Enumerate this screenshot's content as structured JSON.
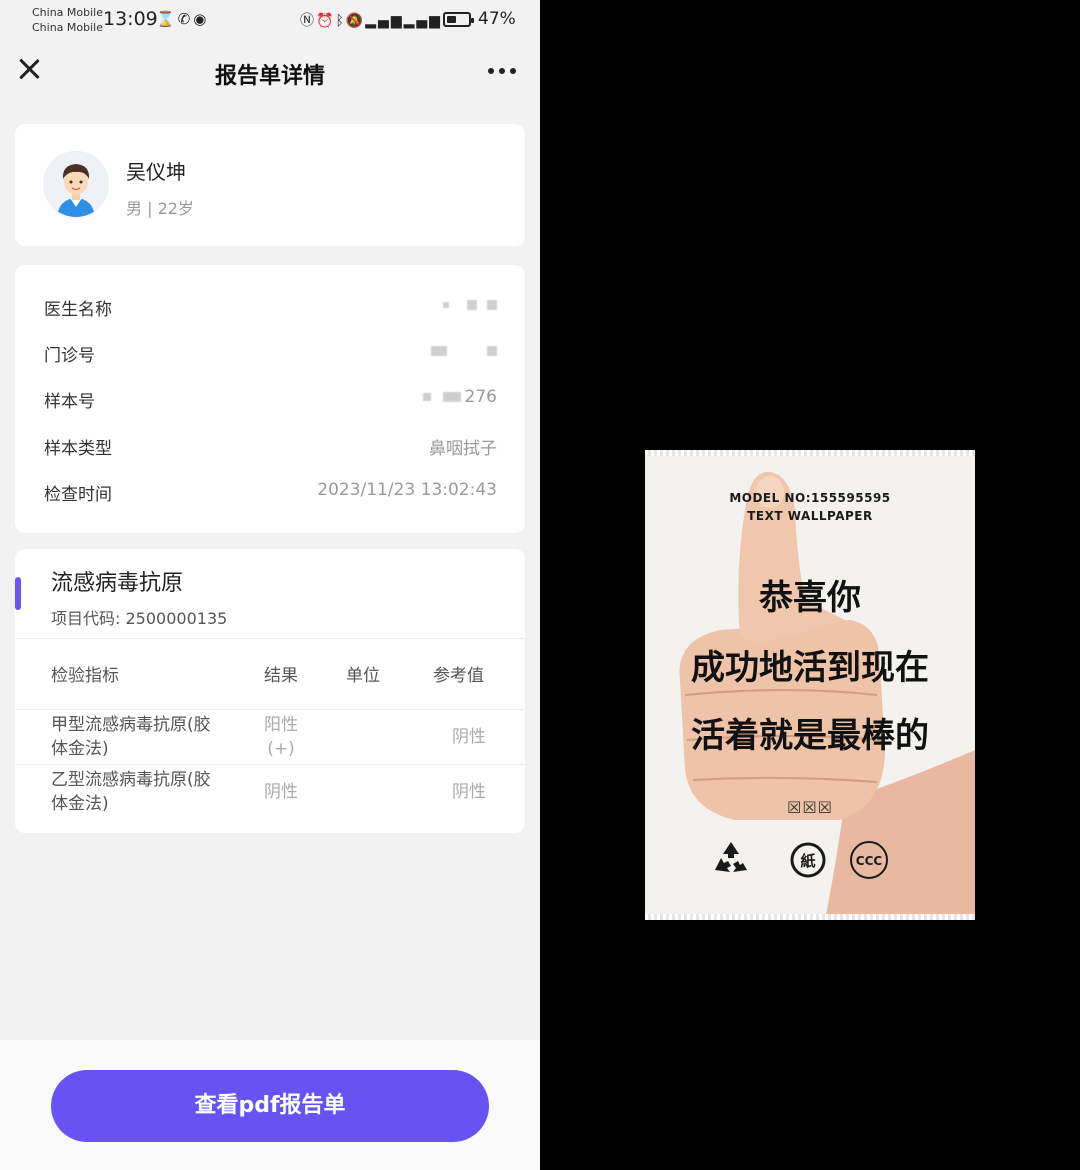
{
  "status_bar": {
    "carrier_1": "China Mobile",
    "carrier_2": "China Mobile",
    "time": "13:09",
    "battery": "47%",
    "battery_level": 0.47
  },
  "nav": {
    "title": "报告单详情"
  },
  "patient": {
    "name": "吴仪坤",
    "meta": "男 | 22岁"
  },
  "info": {
    "rows": [
      {
        "label": "医生名称",
        "value": ""
      },
      {
        "label": "门诊号",
        "value": ""
      },
      {
        "label": "样本号",
        "value": "276"
      },
      {
        "label": "样本类型",
        "value": "鼻咽拭子"
      },
      {
        "label": "检查时间",
        "value": "2023/11/23 13:02:43"
      }
    ]
  },
  "project": {
    "title": "流感病毒抗原",
    "code_label": "项目代码:",
    "code_value": "2500000135",
    "columns": [
      "检验指标",
      "结果",
      "单位",
      "参考值"
    ],
    "rows": [
      {
        "name_line1": "甲型流感病毒抗原(胶",
        "name_line2": "体金法)",
        "result_line1": "阳性",
        "result_line2": "(+)",
        "unit": "",
        "reference": "阴性"
      },
      {
        "name_line1": "乙型流感病毒抗原(胶",
        "name_line2": "体金法)",
        "result_line1": "阴性",
        "result_line2": "",
        "unit": "",
        "reference": "阴性"
      }
    ]
  },
  "footer": {
    "view_pdf_label": "查看pdf报告单"
  },
  "photo": {
    "model_line1": "MODEL NO:155595595",
    "model_line2": "TEXT WALLPAPER",
    "line1": "恭喜你",
    "line2": "成功地活到现在",
    "line3": "活着就是最棒的",
    "marks": "☒☒☒",
    "cert_paper": "紙",
    "cert_ccc": "CCC"
  },
  "colors": {
    "accent": "#6852f3",
    "page_bg": "#f2f2f2",
    "card_bg": "#ffffff"
  }
}
